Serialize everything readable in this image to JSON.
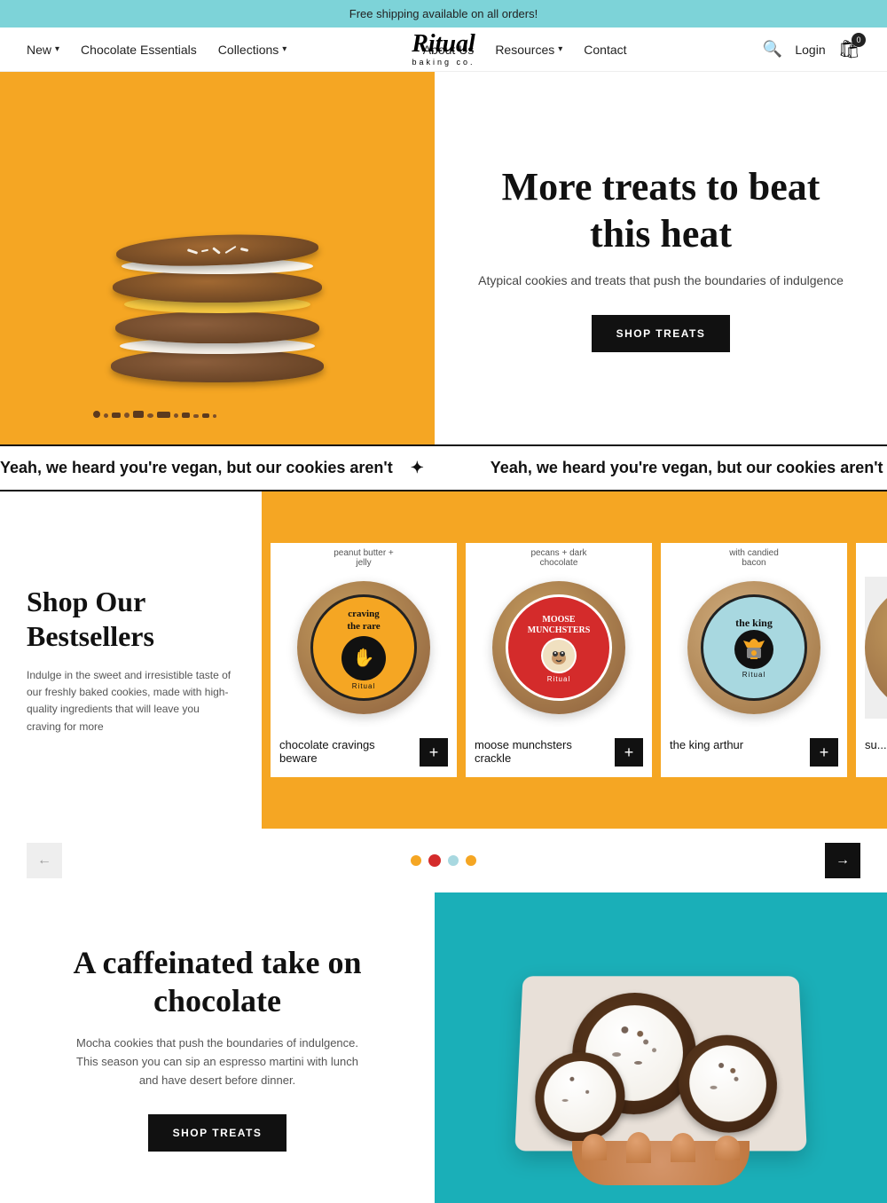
{
  "announcement": {
    "text": "Free shipping available on all orders!"
  },
  "nav": {
    "new_label": "New",
    "chocolate_essentials_label": "Chocolate Essentials",
    "collections_label": "Collections",
    "brand_name": "Ritual",
    "brand_sub": "baking co.",
    "about_label": "About Us",
    "resources_label": "Resources",
    "contact_label": "Contact",
    "login_label": "Login",
    "cart_count": "0"
  },
  "hero": {
    "title": "More treats to beat this heat",
    "subtitle": "Atypical cookies and treats that push the boundaries of indulgence",
    "cta_label": "SHOP TREATS"
  },
  "marquee": {
    "items": [
      "Yeah, we heard you're vegan, but our cookies aren't",
      "Yeah, we heard you're vegan, but our cookies aren't",
      "Yeah, we heard you're vegan, but our cookies aren't",
      "Yeah, we heard you're vegan, but our cookies aren't"
    ]
  },
  "bestsellers": {
    "title": "Shop Our Bestsellers",
    "description": "Indulge in the sweet and irresistible taste of our freshly baked cookies, made with high-quality ingredients that will leave you craving for more",
    "products": [
      {
        "id": 1,
        "name": "chocolate cravings beware",
        "flavor_line1": "peanut butter +",
        "flavor_line2": "jelly",
        "badge_color": "#f5a623",
        "badge_label": "craving the rare"
      },
      {
        "id": 2,
        "name": "moose munchsters crackle",
        "flavor_line1": "pecans + dark",
        "flavor_line2": "chocolate",
        "badge_color": "#d42b2b",
        "badge_label": "moose munchsters"
      },
      {
        "id": 3,
        "name": "the king arthur",
        "flavor_line1": "with candied",
        "flavor_line2": "bacon",
        "badge_color": "#a8d8e0",
        "badge_label": "the king"
      }
    ],
    "partial_label": "su... be..."
  },
  "carousel": {
    "dots": [
      {
        "color": "#f5a623",
        "active": false
      },
      {
        "color": "#d42b2b",
        "active": true
      },
      {
        "color": "#a8d8e0",
        "active": false
      },
      {
        "color": "#f5a623",
        "active": false
      }
    ],
    "prev_label": "←",
    "next_label": "→"
  },
  "coffee": {
    "title": "A caffeinated take on chocolate",
    "description": "Mocha cookies that push the boundaries of indulgence. This season you can sip an espresso martini with lunch and have desert before dinner.",
    "cta_label": "SHOP TREATS"
  }
}
